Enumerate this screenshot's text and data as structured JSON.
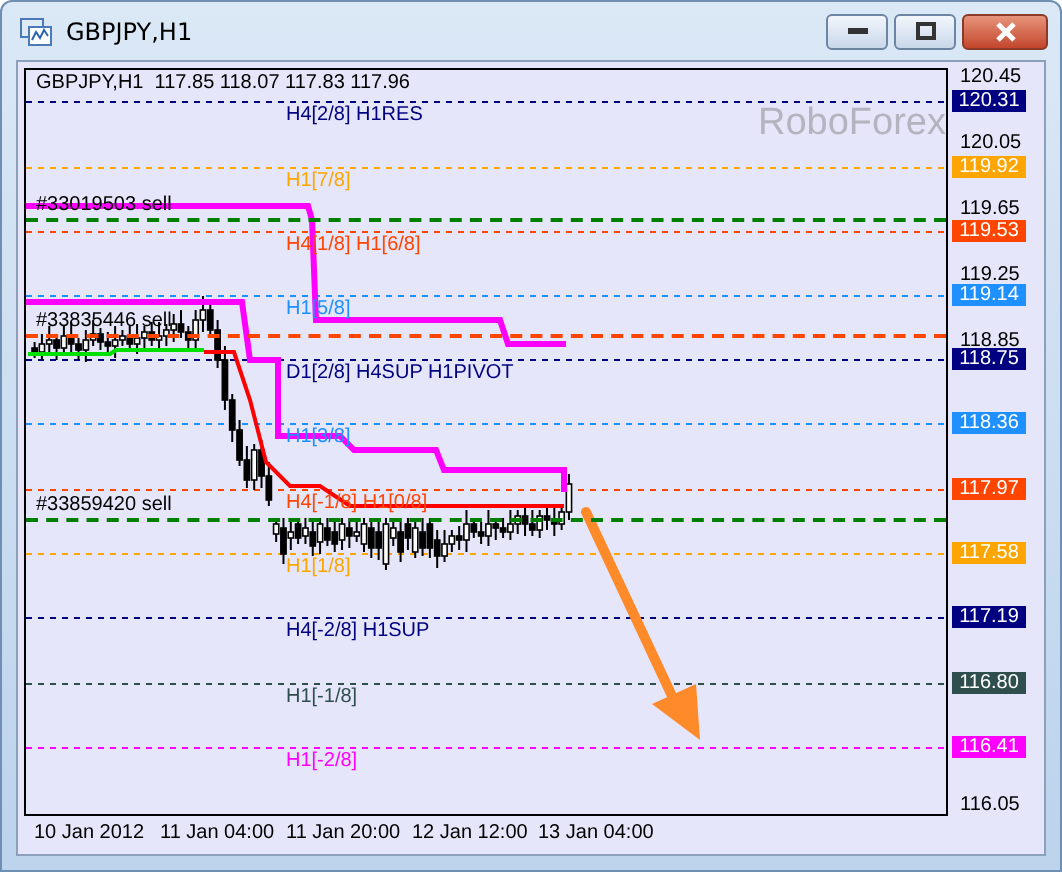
{
  "window": {
    "title": "GBPJPY,H1"
  },
  "chart": {
    "header": "GBPJPY,H1  117.85 118.07 117.83 117.96",
    "watermark": "RoboForex",
    "orders": [
      {
        "label": "#33019503 sell",
        "color": "#008000"
      },
      {
        "label": "#33835446 sell",
        "color": "#ff4500"
      },
      {
        "label": "#33859420 sell",
        "color": "#008000"
      }
    ],
    "levels": [
      {
        "label": "H4[2/8] H1RES",
        "price": "120.31",
        "color": "#000080"
      },
      {
        "label": "H1[7/8]",
        "price": "119.92",
        "color": "#ffa500"
      },
      {
        "label": "H4[1/8] H1[6/8]",
        "price": "119.53",
        "color": "#ff4500"
      },
      {
        "label": "H1[5/8]",
        "price": "119.14",
        "color": "#1e90ff"
      },
      {
        "label": "D1[2/8] H4SUP H1PIVOT",
        "price": "118.75",
        "color": "#000080"
      },
      {
        "label": "H1[3/8]",
        "price": "118.36",
        "color": "#1e90ff"
      },
      {
        "label": "H4[-1/8] H1[0/8]",
        "price": "117.97",
        "color": "#ff4500"
      },
      {
        "label": "H1[1/8]",
        "price": "117.58",
        "color": "#ffa500"
      },
      {
        "label": "H4[-2/8] H1SUP",
        "price": "117.19",
        "color": "#000080"
      },
      {
        "label": "H1[-1/8]",
        "price": "116.80",
        "color": "#2f4f4f"
      },
      {
        "label": "H1[-2/8]",
        "price": "116.41",
        "color": "#ff00ff"
      }
    ],
    "price_ticks": [
      "120.45",
      "120.05",
      "119.65",
      "119.25",
      "118.85",
      "116.05"
    ],
    "time_labels": [
      "10 Jan 2012",
      "11 Jan 04:00",
      "11 Jan 20:00",
      "12 Jan 12:00",
      "13 Jan 04:00"
    ]
  }
}
